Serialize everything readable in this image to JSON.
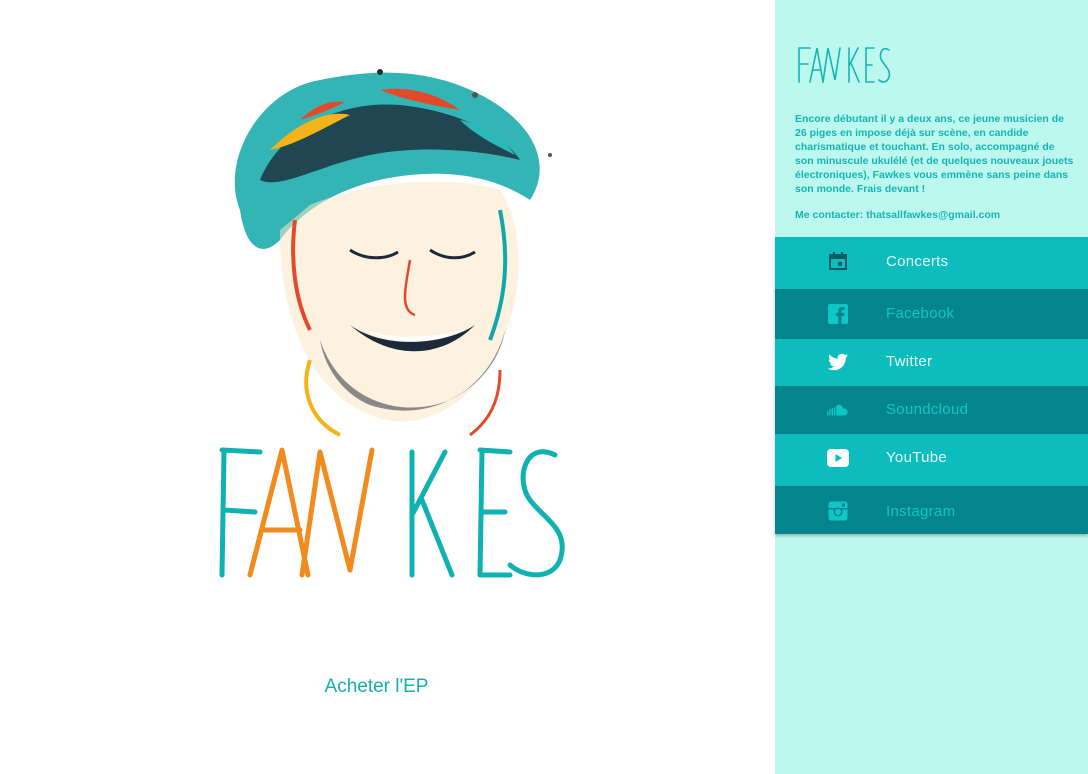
{
  "sidebar": {
    "logo_text": "FAWKES",
    "bio": "Encore débutant il y a deux ans, ce jeune musicien de 26 piges en impose déjà sur scène, en candide charismatique et touchant. En solo, accompagné de son minuscule ukulélé (et de quelques nouveaux jouets électroniques), Fawkes vous emmène sans peine dans son monde. Frais devant !",
    "contact": "Me contacter: thatsallfawkes@gmail.com",
    "nav": [
      {
        "label": "Concerts",
        "icon": "calendar-icon"
      },
      {
        "label": "Facebook",
        "icon": "facebook-icon"
      },
      {
        "label": "Twitter",
        "icon": "twitter-icon"
      },
      {
        "label": "Soundcloud",
        "icon": "soundcloud-icon"
      },
      {
        "label": "YouTube",
        "icon": "youtube-icon"
      },
      {
        "label": "Instagram",
        "icon": "instagram-icon"
      }
    ]
  },
  "main": {
    "artwork_logo_text": "FAWKES",
    "buy_label": "Acheter l'EP"
  },
  "colors": {
    "sidebar_bg": "#bdf8ee",
    "teal_light": "#0dbcbc",
    "teal_dark": "#04848c",
    "accent_text": "#14b0b0",
    "logo_orange": "#f28a1e"
  }
}
